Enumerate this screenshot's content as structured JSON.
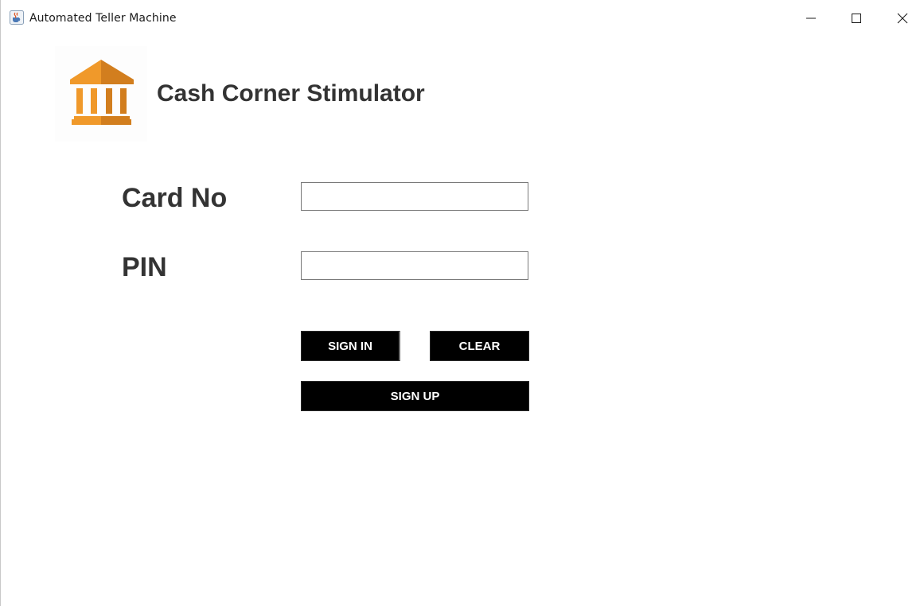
{
  "window": {
    "title": "Automated Teller Machine",
    "app_icon": "java-cup-icon",
    "controls": [
      "minimize-icon",
      "maximize-icon",
      "close-icon"
    ]
  },
  "header": {
    "logo_icon": "bank-building-icon",
    "title": "Cash Corner Stimulator"
  },
  "form": {
    "card_label": "Card No",
    "card_value": "",
    "pin_label": "PIN",
    "pin_value": ""
  },
  "buttons": {
    "sign_in": "SIGN IN",
    "clear": "CLEAR",
    "sign_up": "SIGN UP"
  },
  "colors": {
    "logo_orange_light": "#F0992A",
    "logo_orange_dark": "#D27E1E",
    "text_dark": "#333333",
    "button_bg": "#000000",
    "button_text": "#FFFFFF"
  }
}
